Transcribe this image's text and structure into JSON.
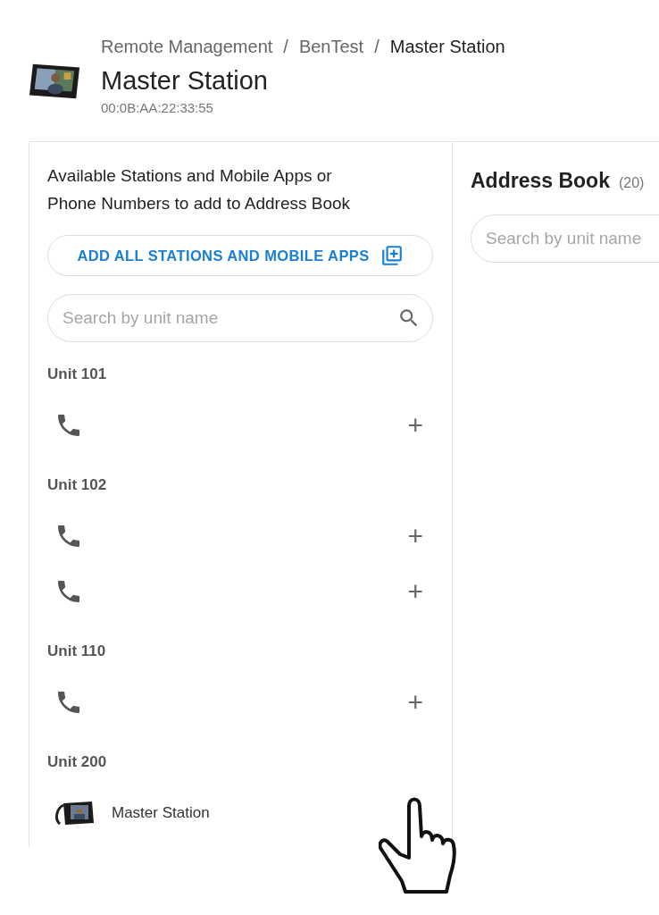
{
  "breadcrumb": [
    {
      "label": "Remote Management",
      "current": false
    },
    {
      "label": "BenTest",
      "current": false
    },
    {
      "label": "Master Station",
      "current": true
    }
  ],
  "breadcrumb_separators": [
    "/",
    "/"
  ],
  "header": {
    "title": "Master Station",
    "mac": "00:0B:AA:22:33:55"
  },
  "available": {
    "heading": "Available Stations and Mobile Apps or Phone Numbers to add to Address Book",
    "add_all_button": "ADD ALL STATIONS AND MOBILE APPS",
    "search": {
      "placeholder": "Search by unit name"
    },
    "units": [
      {
        "name": "Unit 101",
        "entries": [
          {
            "kind": "phone",
            "add": "+"
          }
        ]
      },
      {
        "name": "Unit 102",
        "entries": [
          {
            "kind": "phone",
            "add": "+"
          },
          {
            "kind": "phone",
            "add": "+"
          }
        ]
      },
      {
        "name": "Unit 110",
        "entries": [
          {
            "kind": "phone",
            "add": "+"
          }
        ]
      },
      {
        "name": "Unit 200",
        "entries": [
          {
            "kind": "station",
            "name": "Master Station"
          }
        ]
      }
    ]
  },
  "address_book": {
    "title": "Address Book",
    "count": "(20)",
    "search": {
      "placeholder": "Search by unit name"
    }
  }
}
